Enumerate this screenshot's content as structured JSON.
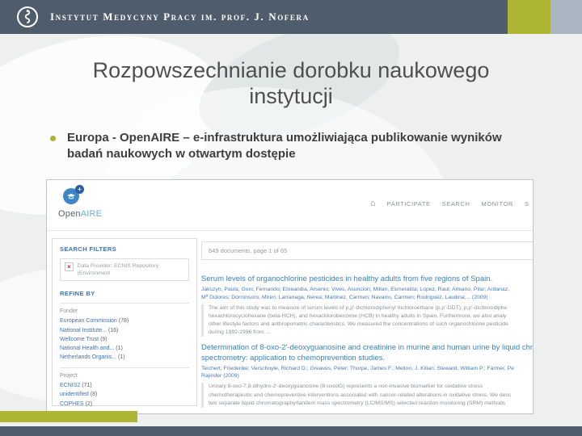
{
  "slide": {
    "header": {
      "org_name": "Instytut Medycyny Pracy im. prof. J. Nofera"
    },
    "title": {
      "line1": "Rozpowszechnianie dorobku naukowego",
      "line2": "instytucji"
    },
    "bullet": "Europa - OpenAIRE – e-infrastruktura umożliwiająca publikowanie wyników badań naukowych w otwartym dostępie",
    "colors": {
      "topbar": "#4e5c6c",
      "accent_olive": "#aeb535",
      "accent_gray": "#a9b6c1",
      "link_blue": "#3a72b8"
    }
  },
  "openaire": {
    "logo": {
      "open": "Open",
      "aire": "AIRE",
      "plus": "+"
    },
    "nav": {
      "home_icon": "⌂",
      "items": [
        {
          "label": "PARTICIPATE"
        },
        {
          "label": "SEARCH"
        },
        {
          "label": "MONITOR"
        },
        {
          "label": "S"
        }
      ]
    },
    "sidebar": {
      "search_filters_label": "SEARCH FILTERS",
      "chip_close": "×",
      "chip_label": "Data Provider: ECNIS Repository (Environment",
      "refine_by_label": "REFINE BY",
      "groups": [
        {
          "name": "Funder",
          "links": [
            {
              "label": "European Commission",
              "count": "(78)"
            },
            {
              "label": "National Institute...",
              "count": "(16)"
            },
            {
              "label": "Wellcome Trust",
              "count": "(9)"
            },
            {
              "label": "National Health and...",
              "count": "(1)"
            },
            {
              "label": "Netherlands Organis...",
              "count": "(1)"
            }
          ]
        },
        {
          "name": "Project",
          "links": [
            {
              "label": "ECNIS2",
              "count": "(71)"
            },
            {
              "label": "unidentified",
              "count": "(8)"
            },
            {
              "label": "COPHES",
              "count": "(2)"
            }
          ]
        }
      ]
    },
    "results_summary": "649 documents, page 1 of 65",
    "results": [
      {
        "title1": "Serum levels of organochlorine pesticides in healthy adults from five regions of Spain.",
        "title2": "",
        "authors1": "Jakszyn, Paula; Goni, Fernando; Etxeandia, Arsenio; Vives, Asuncion; Millan, Esmeralda; Lopez, Raul; Amiano, Pilar; Ardanaz,",
        "authors2": "Mª Dolores; Dorronsoro, Miren; Larranaga, Nerea; Martinez, Carmen; Navarro, Carmen; Rodriguez, Laudina;... (2009)",
        "abs1": "The aim of this study was to measure of serum levels of p,p'-dichlorodiphenyl trichloroethane (p,p'-DDT), p,p'-dichlorodiphe",
        "abs2": "hexachlorocyclohexane (beta-HCH), and hexachlorobenzene (HCB) in healthy adults in Spain. Furthermore, we also analy",
        "abs3": "other lifestyle factors and anthropometric characteristics. We measured the concentrations of such organochlorine pesticide",
        "abs4": "during 1992-1996 from ..."
      },
      {
        "title1": "Determination of 8-oxo-2'-deoxyguanosine and creatinine in murine and human urine by liquid chro",
        "title2": "spectrometry: application to chemoprevention studies.",
        "authors1": "Teichert, Friederike; Verschoyle, Richard D.; Greaves, Peter; Thorpe, James F.; Mellon, J. Kilian; Steward, William P.; Farmer, Pe",
        "authors2": "Rajinder (2009)",
        "abs1": "Urinary 8-oxo-7,8-dihydro-2'-deoxyguanosine (8-oxodG) represents a non-invasive biomarker for oxidative stress",
        "abs2": "chemotherapeutic and chemopreventive interventions associated with cancer-related alterations in oxidative stress. We desc",
        "abs3": "two separate liquid chromatography/tandem mass spectrometry (LC/MS/MS) selected reaction monitoring (SRM) methods",
        "abs4": ""
      }
    ]
  }
}
